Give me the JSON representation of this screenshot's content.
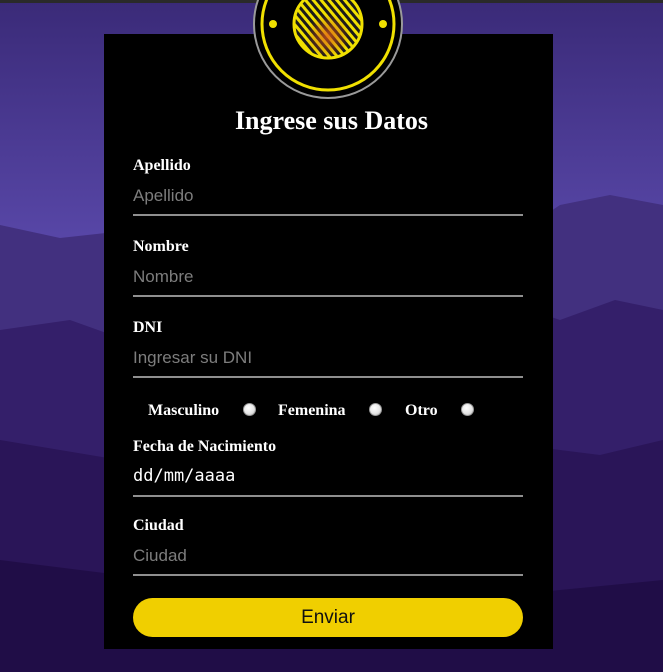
{
  "form": {
    "title": "Ingrese sus Datos",
    "fields": [
      {
        "label": "Apellido",
        "placeholder": "Apellido"
      },
      {
        "label": "Nombre",
        "placeholder": "Nombre"
      },
      {
        "label": "DNI",
        "placeholder": "Ingresar su DNI"
      }
    ],
    "gender_options": [
      "Masculino",
      "Femenina",
      "Otro"
    ],
    "birth_date": {
      "label": "Fecha de Nacimiento",
      "value": "dd/mm/aaaa"
    },
    "city": {
      "label": "Ciudad",
      "placeholder": "Ciudad"
    },
    "submit_label": "Enviar"
  },
  "colors": {
    "accent": "#f0cf00",
    "card": "#000000",
    "background": "#3d2a7e"
  },
  "icons": {
    "logo": "yellow-target-logo-icon"
  }
}
